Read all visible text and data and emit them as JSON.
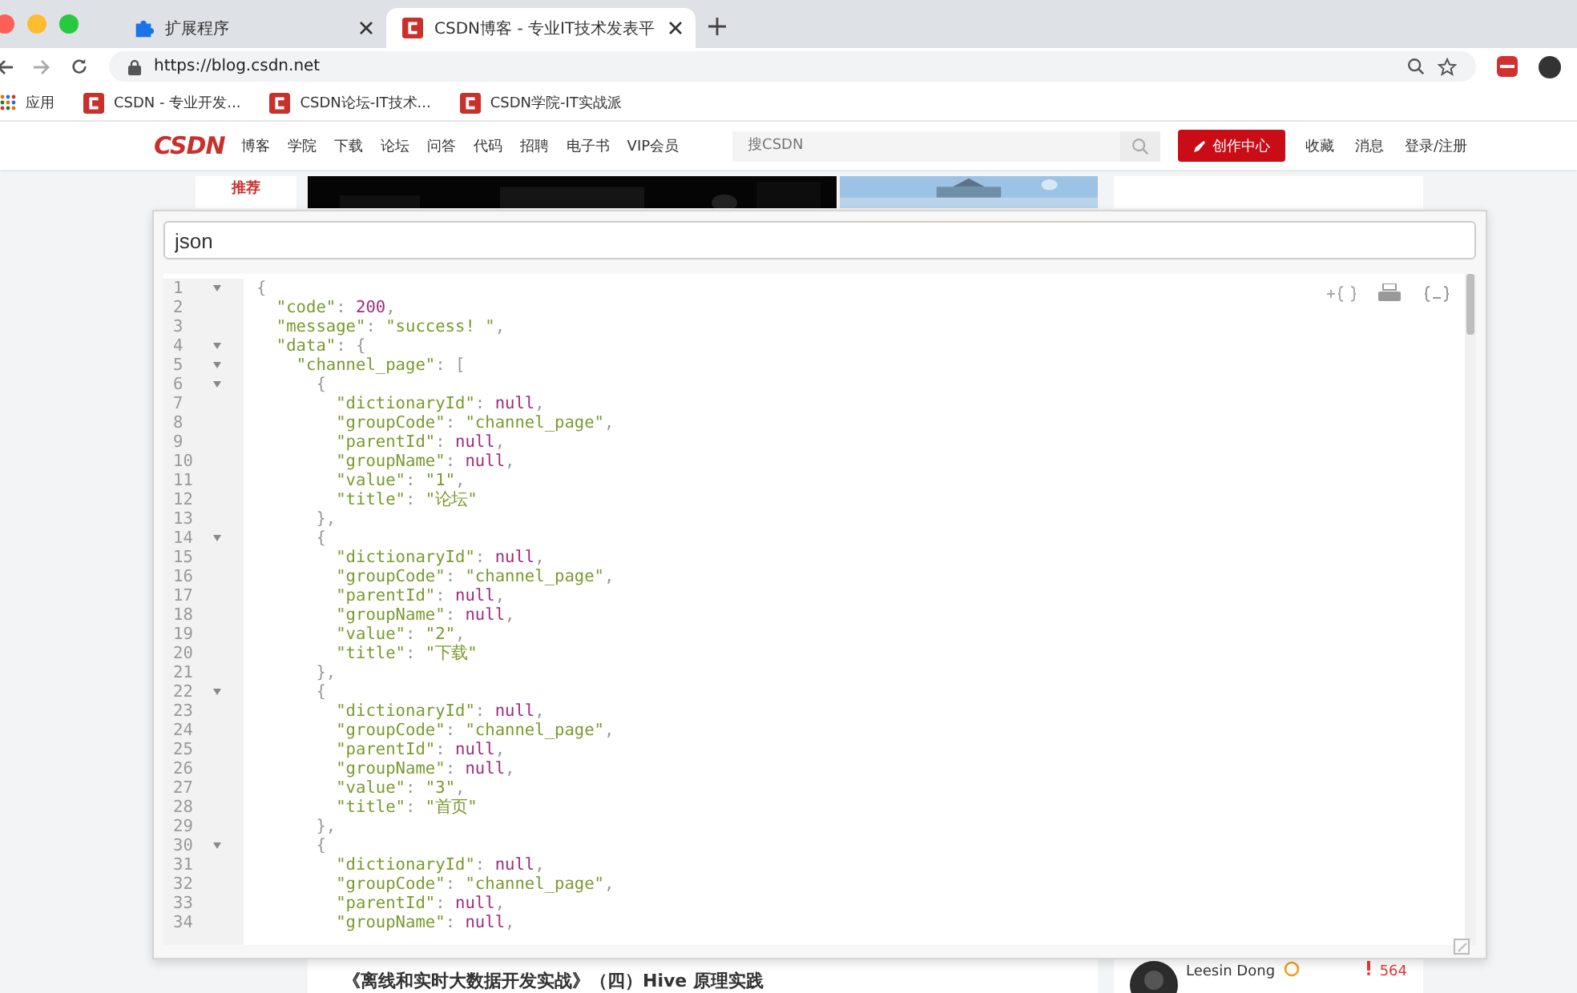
{
  "browser": {
    "tabs": [
      {
        "title": "扩展程序",
        "selected": false
      },
      {
        "title": "CSDN博客 - 专业IT技术发表平",
        "selected": true
      }
    ],
    "url": "https://blog.csdn.net",
    "bookmarks": [
      {
        "label": "应用",
        "kind": "apps"
      },
      {
        "label": "CSDN - 专业开发...",
        "kind": "site"
      },
      {
        "label": "CSDN论坛-IT技术...",
        "kind": "site"
      },
      {
        "label": "CSDN学院-IT实战派",
        "kind": "site"
      }
    ]
  },
  "site_header": {
    "logo": "CSDN",
    "nav": [
      "博客",
      "学院",
      "下载",
      "论坛",
      "问答",
      "代码",
      "招聘",
      "电子书",
      "VIP会员"
    ],
    "search": {
      "placeholder": "搜CSDN"
    },
    "create_button": "创作中心",
    "links": [
      "收藏",
      "消息",
      "登录/注册"
    ]
  },
  "background": {
    "sidebar_tab": "推荐",
    "article_title": "《离线和实时大数据开发实战》（四）Hive 原理实践",
    "author": "Leesin Dong",
    "score": "564"
  },
  "json_viewer": {
    "query": "json",
    "lines": [
      {
        "number": "1",
        "foldable": true,
        "text": "{"
      },
      {
        "number": "2",
        "foldable": false,
        "text": "  \"code\": 200,"
      },
      {
        "number": "3",
        "foldable": false,
        "text": "  \"message\": \"success! \","
      },
      {
        "number": "4",
        "foldable": true,
        "text": "  \"data\": {"
      },
      {
        "number": "5",
        "foldable": true,
        "text": "    \"channel_page\": ["
      },
      {
        "number": "6",
        "foldable": true,
        "text": "      {"
      },
      {
        "number": "7",
        "foldable": false,
        "text": "        \"dictionaryId\": null,"
      },
      {
        "number": "8",
        "foldable": false,
        "text": "        \"groupCode\": \"channel_page\","
      },
      {
        "number": "9",
        "foldable": false,
        "text": "        \"parentId\": null,"
      },
      {
        "number": "10",
        "foldable": false,
        "text": "        \"groupName\": null,"
      },
      {
        "number": "11",
        "foldable": false,
        "text": "        \"value\": \"1\","
      },
      {
        "number": "12",
        "foldable": false,
        "text": "        \"title\": \"论坛\""
      },
      {
        "number": "13",
        "foldable": false,
        "text": "      },"
      },
      {
        "number": "14",
        "foldable": true,
        "text": "      {"
      },
      {
        "number": "15",
        "foldable": false,
        "text": "        \"dictionaryId\": null,"
      },
      {
        "number": "16",
        "foldable": false,
        "text": "        \"groupCode\": \"channel_page\","
      },
      {
        "number": "17",
        "foldable": false,
        "text": "        \"parentId\": null,"
      },
      {
        "number": "18",
        "foldable": false,
        "text": "        \"groupName\": null,"
      },
      {
        "number": "19",
        "foldable": false,
        "text": "        \"value\": \"2\","
      },
      {
        "number": "20",
        "foldable": false,
        "text": "        \"title\": \"下载\""
      },
      {
        "number": "21",
        "foldable": false,
        "text": "      },"
      },
      {
        "number": "22",
        "foldable": true,
        "text": "      {"
      },
      {
        "number": "23",
        "foldable": false,
        "text": "        \"dictionaryId\": null,"
      },
      {
        "number": "24",
        "foldable": false,
        "text": "        \"groupCode\": \"channel_page\","
      },
      {
        "number": "25",
        "foldable": false,
        "text": "        \"parentId\": null,"
      },
      {
        "number": "26",
        "foldable": false,
        "text": "        \"groupName\": null,"
      },
      {
        "number": "27",
        "foldable": false,
        "text": "        \"value\": \"3\","
      },
      {
        "number": "28",
        "foldable": false,
        "text": "        \"title\": \"首页\""
      },
      {
        "number": "29",
        "foldable": false,
        "text": "      },"
      },
      {
        "number": "30",
        "foldable": true,
        "text": "      {"
      },
      {
        "number": "31",
        "foldable": false,
        "text": "        \"dictionaryId\": null,"
      },
      {
        "number": "32",
        "foldable": false,
        "text": "        \"groupCode\": \"channel_page\","
      },
      {
        "number": "33",
        "foldable": false,
        "text": "        \"parentId\": null,"
      },
      {
        "number": "34",
        "foldable": false,
        "text": "        \"groupName\": null,"
      }
    ]
  }
}
